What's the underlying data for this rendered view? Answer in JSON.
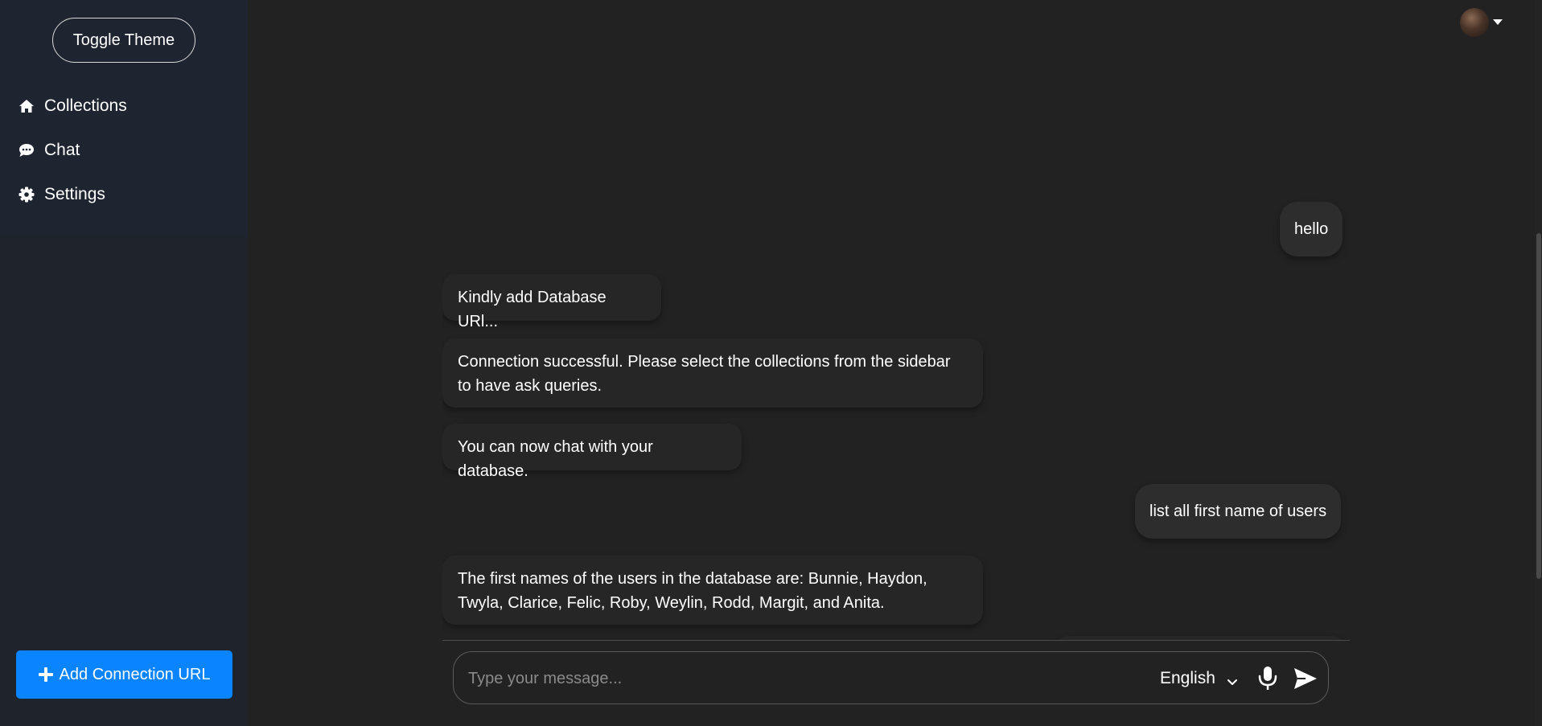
{
  "sidebar": {
    "toggle_theme_label": "Toggle Theme",
    "items": [
      {
        "label": "Collections",
        "icon": "home-icon"
      },
      {
        "label": "Chat",
        "icon": "chat-bubble-icon"
      },
      {
        "label": "Settings",
        "icon": "gear-icon"
      }
    ],
    "add_connection_label": "Add Connection URL"
  },
  "header": {
    "avatar_icon": "user-avatar",
    "menu_icon": "caret-down-icon"
  },
  "messages": [
    {
      "role": "user",
      "text": "hello"
    },
    {
      "role": "bot",
      "text": "Kindly add Database URl..."
    },
    {
      "role": "bot",
      "text": "Connection successful. Please select the collections from the sidebar to have ask queries."
    },
    {
      "role": "bot",
      "text": "You can now chat with your database."
    },
    {
      "role": "user",
      "text": "list all first name of users"
    },
    {
      "role": "bot",
      "text": "The first names of the users in the database are: Bunnie, Haydon, Twyla, Clarice, Felic, Roby, Weylin, Rodd, Margit, and Anita."
    }
  ],
  "composer": {
    "placeholder": "Type your message...",
    "language": "English",
    "mic_icon": "microphone-icon",
    "send_icon": "send-icon"
  },
  "colors": {
    "background": "#222222",
    "sidebar": "#1f232b",
    "accent": "#0a84ff",
    "bubble": "#262626"
  }
}
